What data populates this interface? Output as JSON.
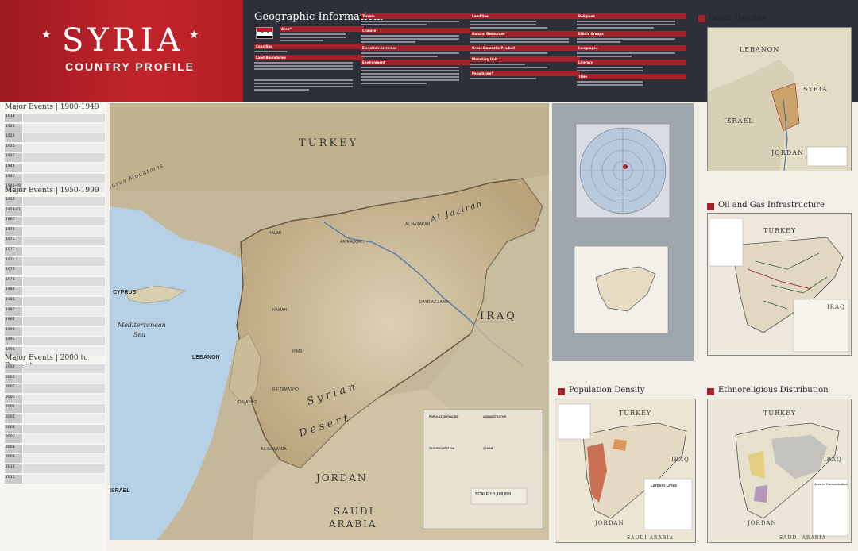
{
  "header": {
    "title": "SYRIA",
    "subtitle": "COUNTRY PROFILE",
    "geo_info_title": "Geographic Information:",
    "sections_col1": [
      "Area*",
      "Coastline",
      "Land Boundaries"
    ],
    "sections_col2": [
      "Terrain",
      "Climate",
      "Elevation Extremes",
      "Environment"
    ],
    "sections_col3": [
      "Land Use",
      "Natural Resources",
      "Gross Domestic Product",
      "Monetary Unit",
      "Population*"
    ],
    "sections_col4": [
      "Religions",
      "Ethnic Groups",
      "Languages",
      "Literacy",
      "Time"
    ]
  },
  "events": {
    "h1": "Major Events | 1900-1949",
    "years1": [
      "1918",
      "1920",
      "1920",
      "1925",
      "1941",
      "1946",
      "1947",
      "1948-49"
    ],
    "h2": "Major Events | 1950-1999",
    "years2": [
      "1955",
      "1958-61",
      "1967",
      "1970",
      "1971",
      "1973",
      "1974",
      "1975",
      "1976",
      "1980",
      "1981",
      "1982",
      "1982",
      "1990",
      "1991",
      "1994"
    ],
    "h3": "Major Events | 2000 to Present",
    "years3": [
      "2000",
      "2001",
      "2002",
      "2003",
      "2004",
      "2005",
      "2006",
      "2007",
      "2008",
      "2009",
      "2010",
      "2011"
    ]
  },
  "main_map": {
    "countries": {
      "turkey": "TURKEY",
      "iraq": "IRAQ",
      "jordan": "JORDAN",
      "saudi_1": "SAUDI",
      "saudi_2": "ARABIA",
      "lebanon": "LEBANON",
      "cyprus": "CYPRUS",
      "israel": "ISRAEL"
    },
    "sea_1": "Mediterranean",
    "sea_2": "Sea",
    "desert_1": "Syrian",
    "desert_2": "Desert",
    "region": "Al Jazirah",
    "mountains": "Taurus Mountains",
    "cities": [
      "HALAB",
      "AR RAQQAH",
      "AL HASAKAH",
      "DAYR AZ ZAWR",
      "HAMAH",
      "HIMS",
      "DIMASHQ",
      "RIF DIMASHQ",
      "AS SUWAYDA"
    ],
    "scale": "SCALE 1:1,100,000",
    "legend_title_1": "POPULATED PLACES",
    "legend_title_2": "ADMINISTRATIVE",
    "legend_title_3": "TRANSPORTATION",
    "legend_title_4": "OTHER"
  },
  "panels": {
    "golan": {
      "title": "Golan Heights",
      "lebanon": "LEBANON",
      "syria": "SYRIA",
      "israel": "ISRAEL",
      "jordan": "JORDAN"
    },
    "oil": {
      "title": "Oil and Gas Infrastructure",
      "turkey": "TURKEY",
      "iraq": "IRAQ"
    },
    "population": {
      "title": "Population Density",
      "turkey": "TURKEY",
      "iraq": "IRAQ",
      "jordan": "JORDAN",
      "saudi": "SAUDI ARABIA",
      "largest_cities": "Largest Cities"
    },
    "ethno": {
      "title": "Ethnoreligious Distribution",
      "turkey": "TURKEY",
      "iraq": "IRAQ",
      "jordan": "JORDAN",
      "saudi": "SAUDI ARABIA",
      "legend_title": "Area of Concentration"
    }
  },
  "colors": {
    "header_bg": "#2d3039",
    "title_red": "#b51f25",
    "land_syria": "#d9c7a8",
    "sea": "#b9d4e8"
  }
}
